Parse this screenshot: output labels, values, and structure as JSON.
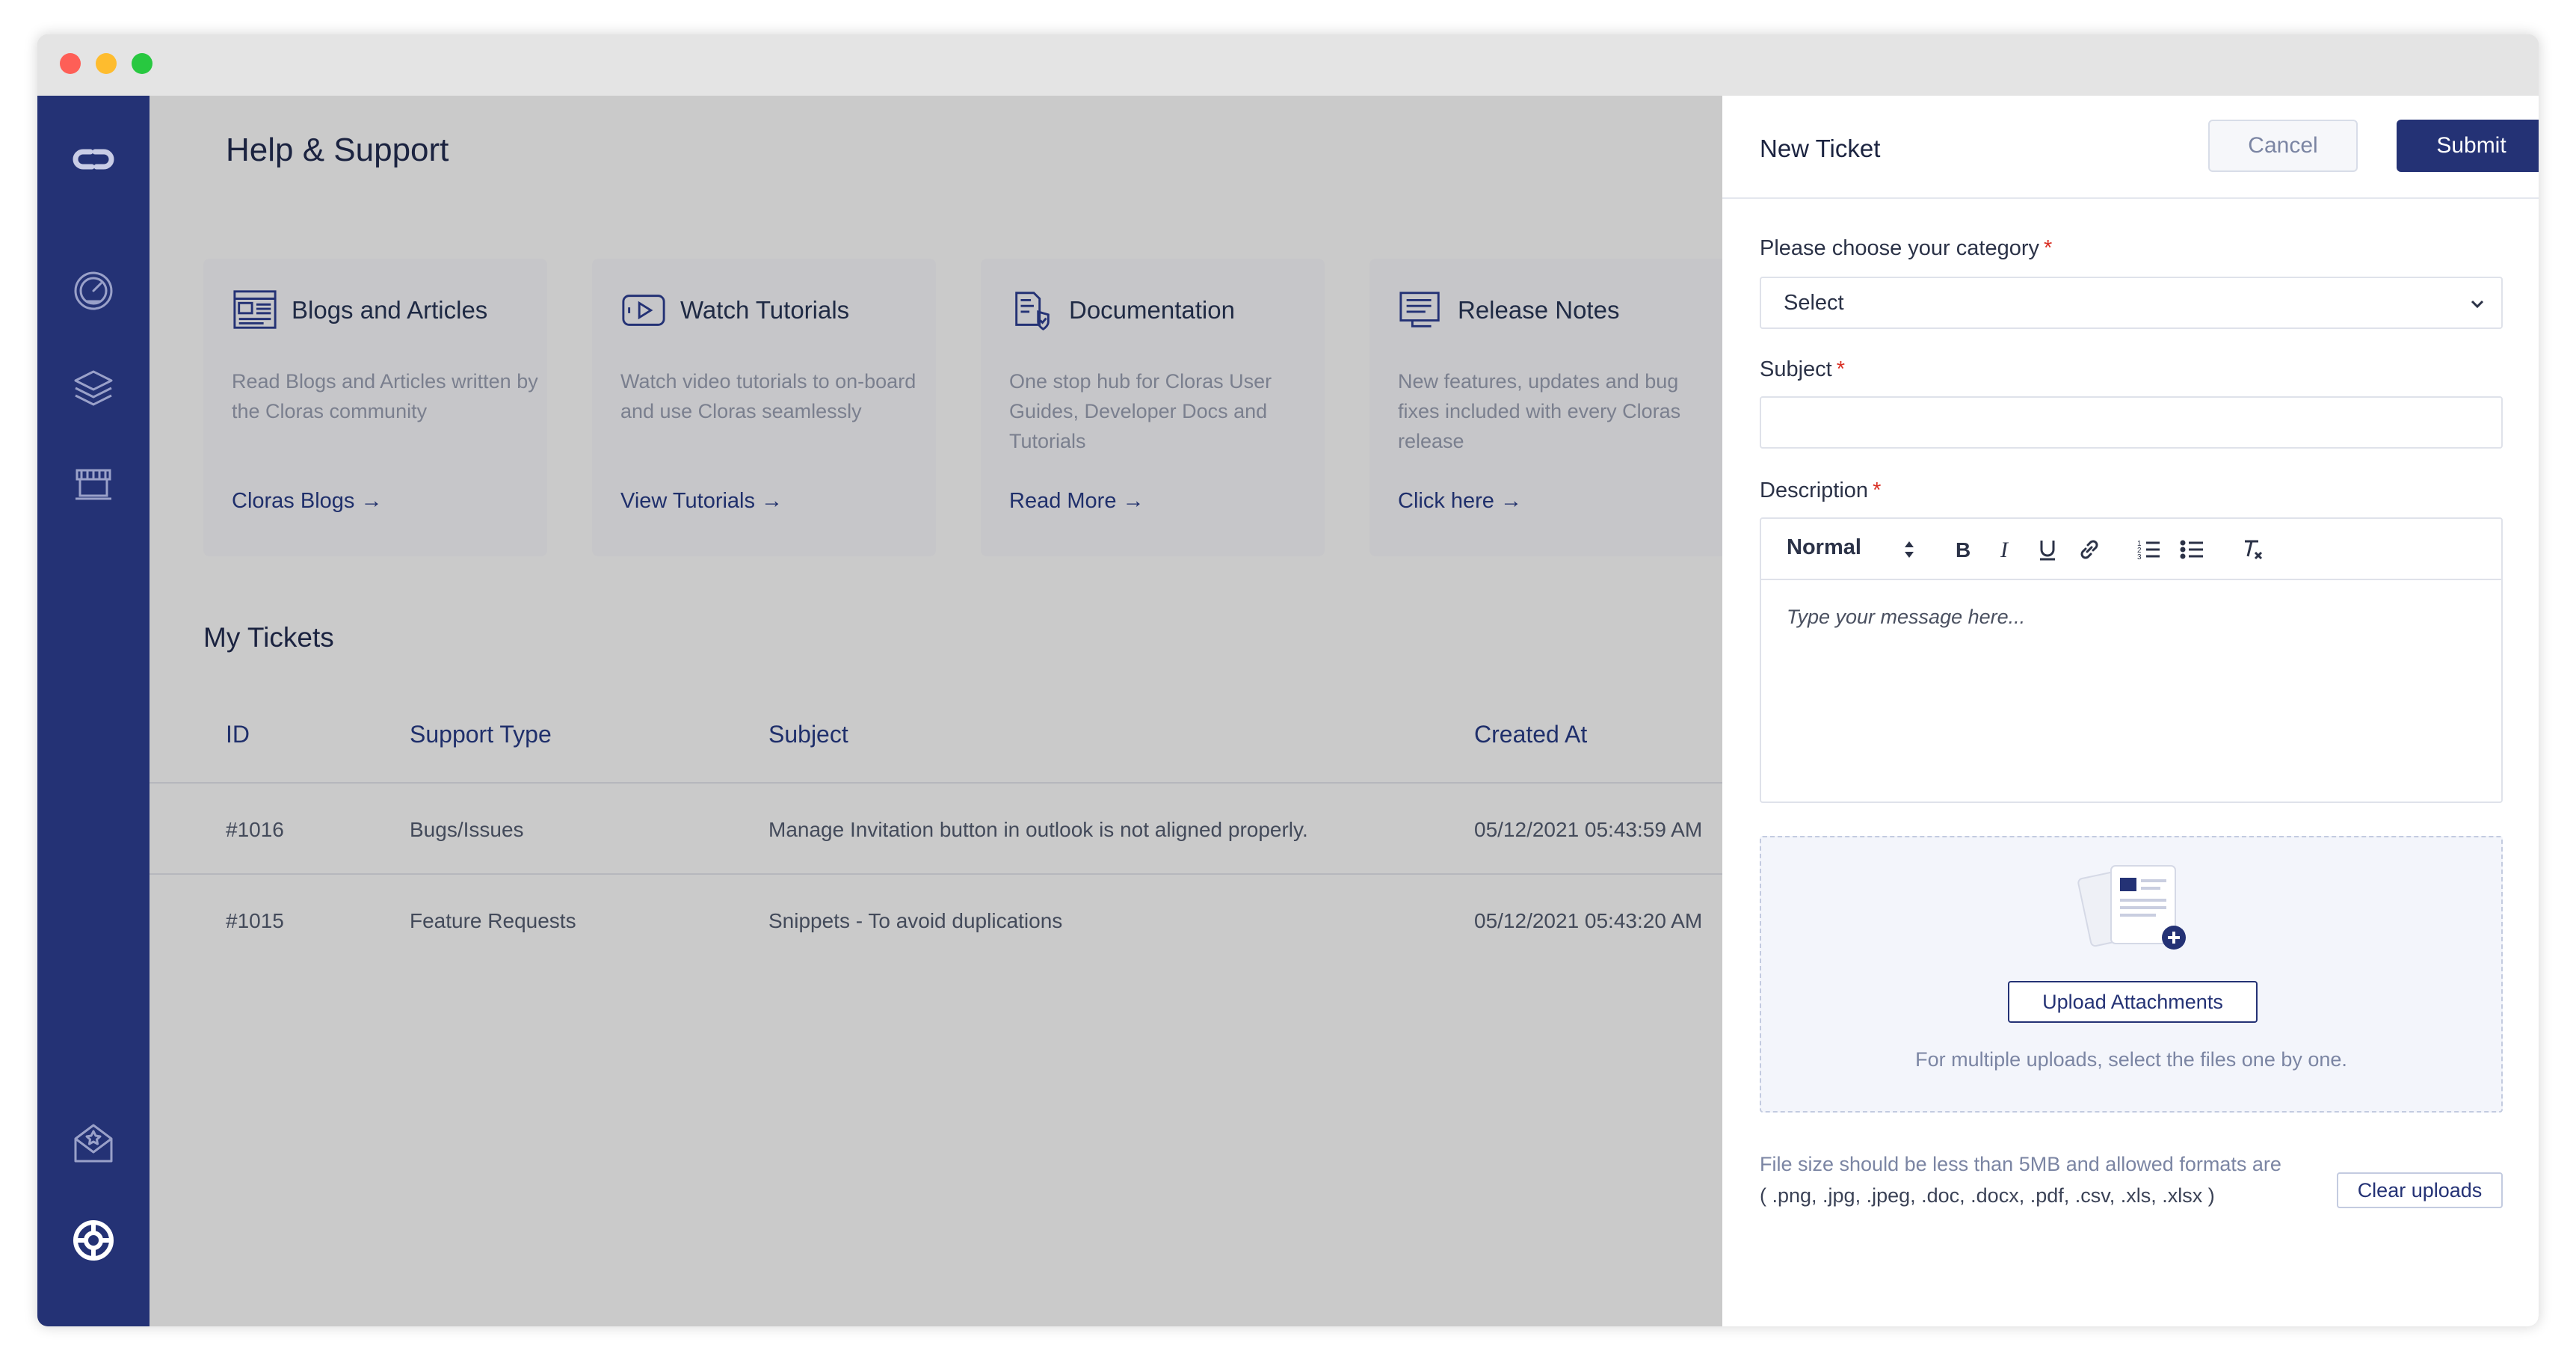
{
  "colors": {
    "brand_navy": "#243275",
    "overlay_gray": "#cacaca",
    "required_red": "#d93025",
    "link_navy": "#1f2f6b"
  },
  "sidebar": {
    "items": [
      {
        "icon": "logo-icon"
      },
      {
        "icon": "dashboard-gauge-icon"
      },
      {
        "icon": "layers-icon"
      },
      {
        "icon": "store-icon"
      },
      {
        "icon": "mail-star-icon"
      },
      {
        "icon": "lifebuoy-icon"
      }
    ]
  },
  "main": {
    "title": "Help & Support",
    "cards": [
      {
        "icon": "blog-icon",
        "title": "Blogs and Articles",
        "desc": "Read Blogs and Articles written by the Cloras community",
        "link": "Cloras Blogs →"
      },
      {
        "icon": "video-icon",
        "title": "Watch Tutorials",
        "desc": "Watch video tutorials to on-board and use Cloras seamlessly",
        "link": "View Tutorials →"
      },
      {
        "icon": "documentation-icon",
        "title": "Documentation",
        "desc": "One stop hub for Cloras User Guides, Developer Docs and Tutorials",
        "link": "Read More →"
      },
      {
        "icon": "release-notes-icon",
        "title": "Release Notes",
        "desc": "New features, updates and bug fixes included with every Cloras release",
        "link": "Click here →"
      }
    ],
    "tickets": {
      "title": "My Tickets",
      "columns": [
        "ID",
        "Support Type",
        "Subject",
        "Created At"
      ],
      "rows": [
        [
          "#1016",
          "Bugs/Issues",
          "Manage Invitation button in outlook is not aligned properly.",
          "05/12/2021 05:43:59 AM"
        ],
        [
          "#1015",
          "Feature Requests",
          "Snippets - To avoid duplications",
          "05/12/2021 05:43:20 AM"
        ]
      ]
    }
  },
  "panel": {
    "title": "New Ticket",
    "cancel_label": "Cancel",
    "submit_label": "Submit",
    "category": {
      "label": "Please choose your category",
      "value": "Select"
    },
    "subject": {
      "label": "Subject",
      "value": ""
    },
    "description": {
      "label": "Description",
      "format_value": "Normal",
      "placeholder": "Type your message here...",
      "toolbar": [
        "bold-icon",
        "italic-icon",
        "underline-icon",
        "link-icon",
        "ordered-list-icon",
        "bullet-list-icon",
        "clear-format-icon"
      ]
    },
    "required_mark": "*",
    "upload": {
      "button_label": "Upload Attachments",
      "hint": "For multiple uploads, select the files one by one."
    },
    "size_note_line1": "File size should be less than 5MB and allowed formats are",
    "size_note_line2": "( .png, .jpg, .jpeg, .doc, .docx, .pdf, .csv, .xls, .xlsx )",
    "clear_label": "Clear uploads"
  }
}
